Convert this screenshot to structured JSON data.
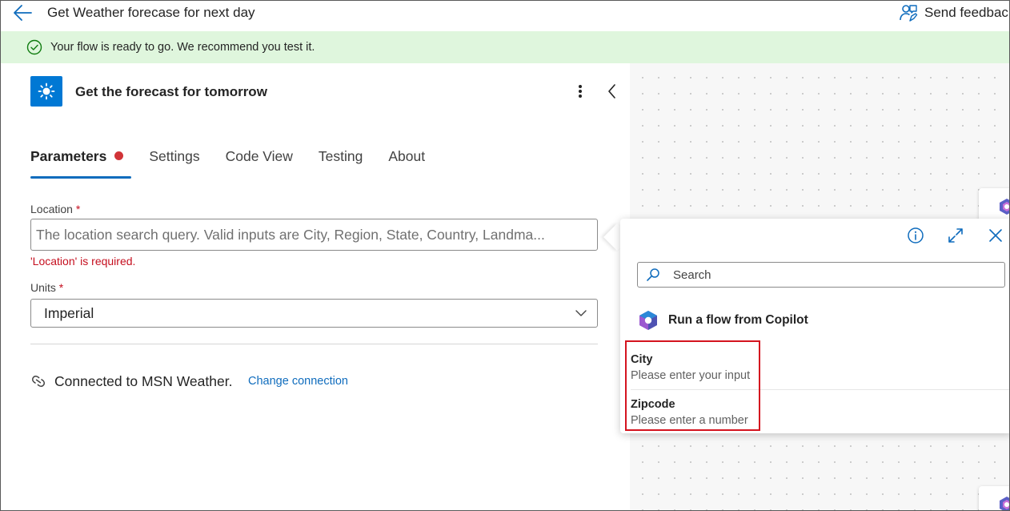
{
  "header": {
    "title": "Get Weather forecase for next day",
    "feedback_label": "Send feedbac"
  },
  "banner": {
    "message": "Your flow is ready to go. We recommend you test it."
  },
  "action": {
    "title": "Get the forecast for tomorrow",
    "icon": "sun-icon",
    "icon_bg": "#0078d4"
  },
  "tabs": [
    {
      "label": "Parameters",
      "active": true,
      "has_error": true
    },
    {
      "label": "Settings"
    },
    {
      "label": "Code View"
    },
    {
      "label": "Testing"
    },
    {
      "label": "About"
    }
  ],
  "form": {
    "location": {
      "label": "Location",
      "required_mark": "*",
      "placeholder": "The location search query. Valid inputs are City, Region, State, Country, Landma...",
      "error": "'Location' is required."
    },
    "units": {
      "label": "Units",
      "required_mark": "*",
      "value": "Imperial"
    }
  },
  "connection": {
    "text": "Connected to MSN Weather.",
    "change_label": "Change connection"
  },
  "flyout": {
    "search_placeholder": "Search",
    "source_title": "Run a flow from Copilot",
    "items": [
      {
        "name": "City",
        "description": "Please enter your input"
      },
      {
        "name": "Zipcode",
        "description": "Please enter a number"
      }
    ]
  },
  "colors": {
    "accent": "#0f6cbd",
    "success_banner": "#dff6dd",
    "error": "#c50f1f",
    "highlight_box": "#d4141f"
  }
}
